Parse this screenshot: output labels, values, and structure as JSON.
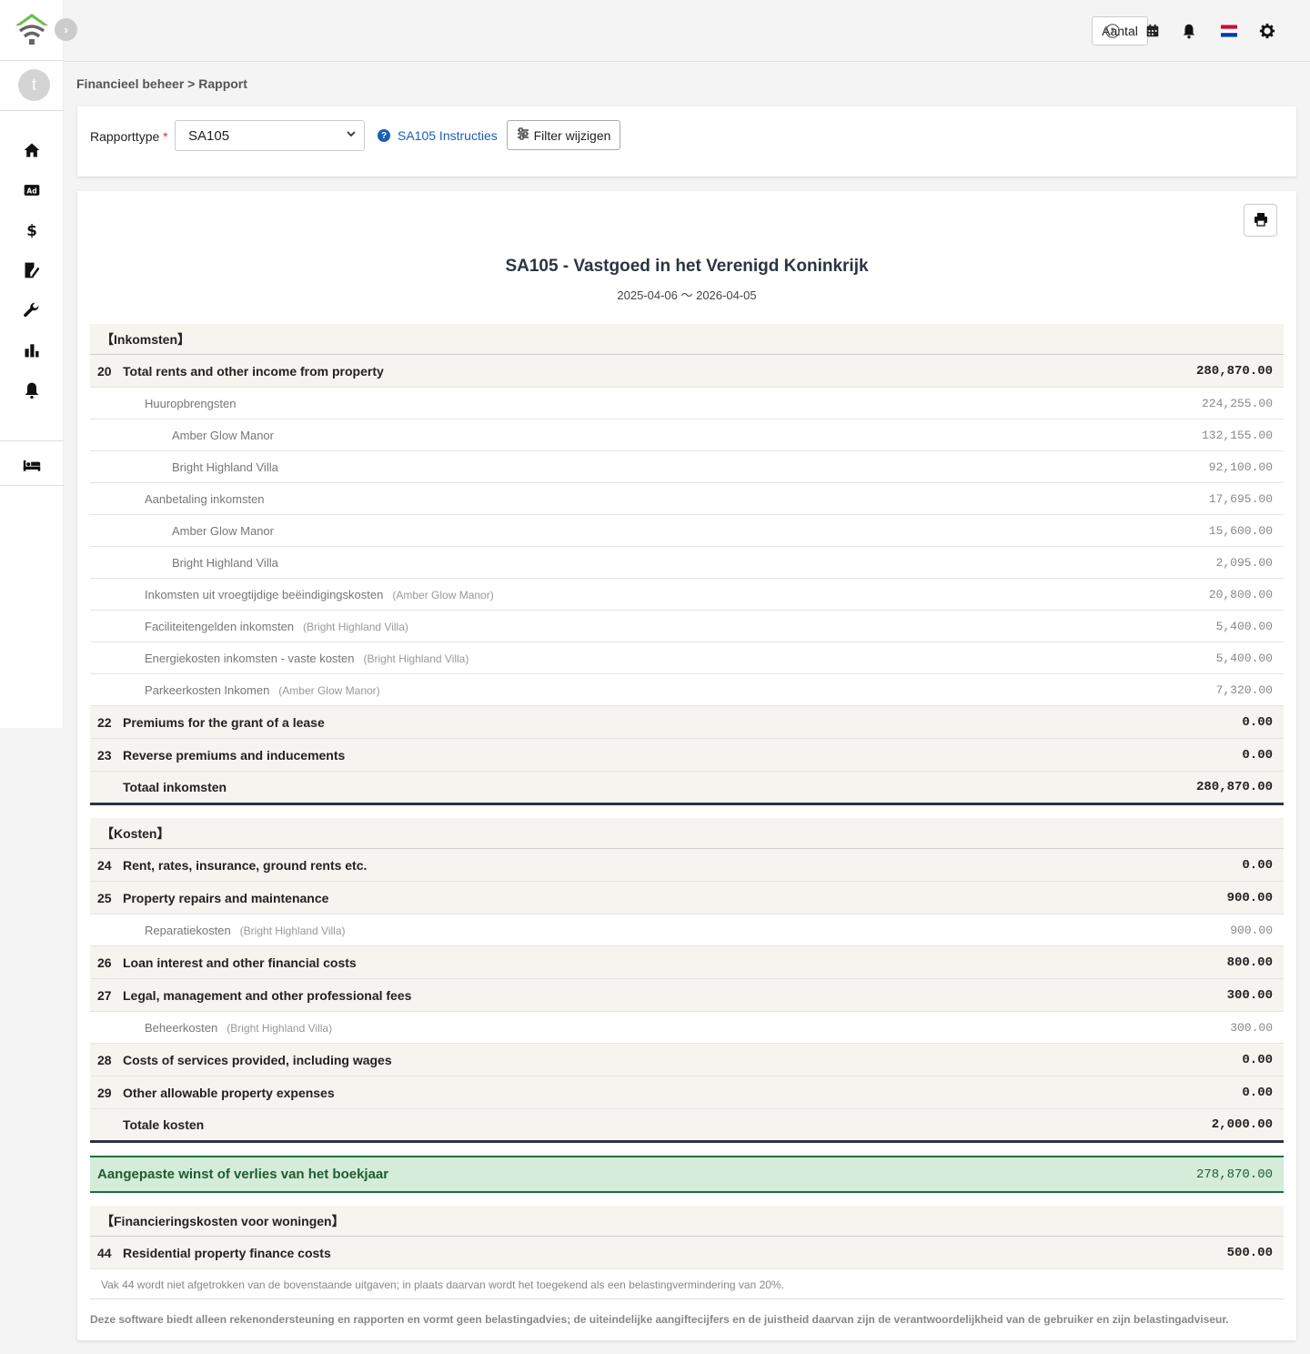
{
  "app": {
    "avatar_letter": "t"
  },
  "topbar": {
    "aantal_label": "Aantal"
  },
  "breadcrumb": {
    "parent": "Financieel beheer",
    "separator": ">",
    "current": "Rapport"
  },
  "filter": {
    "type_label": "Rapporttype",
    "required_mark": "*",
    "selected_type": "SA105",
    "instructions_label": "SA105 Instructies",
    "filter_button_label": "Filter wijzigen"
  },
  "report": {
    "title": "SA105 - Vastgoed in het Verenigd Koninkrijk",
    "period": "2025-04-06 〜 2026-04-05",
    "income": {
      "section_label": "【Inkomsten】",
      "box20": {
        "num": "20",
        "label": "Total rents and other income from property",
        "amount": "280,870.00"
      },
      "rent_income": {
        "label": "Huuropbrengsten",
        "amount": "224,255.00"
      },
      "rent_amber": {
        "label": "Amber Glow Manor",
        "amount": "132,155.00"
      },
      "rent_bright": {
        "label": "Bright Highland Villa",
        "amount": "92,100.00"
      },
      "deposit_income": {
        "label": "Aanbetaling inkomsten",
        "amount": "17,695.00"
      },
      "deposit_amber": {
        "label": "Amber Glow Manor",
        "amount": "15,600.00"
      },
      "deposit_bright": {
        "label": "Bright Highland Villa",
        "amount": "2,095.00"
      },
      "early_term": {
        "label": "Inkomsten uit vroegtijdige beëindigingskosten",
        "property": "(Amber Glow Manor)",
        "amount": "20,800.00"
      },
      "facility": {
        "label": "Faciliteitengelden inkomsten",
        "property": "(Bright Highland Villa)",
        "amount": "5,400.00"
      },
      "energy": {
        "label": "Energiekosten inkomsten - vaste kosten",
        "property": "(Bright Highland Villa)",
        "amount": "5,400.00"
      },
      "parking": {
        "label": "Parkeerkosten Inkomen",
        "property": "(Amber Glow Manor)",
        "amount": "7,320.00"
      },
      "box22": {
        "num": "22",
        "label": "Premiums for the grant of a lease",
        "amount": "0.00"
      },
      "box23": {
        "num": "23",
        "label": "Reverse premiums and inducements",
        "amount": "0.00"
      },
      "total": {
        "label": "Totaal inkomsten",
        "amount": "280,870.00"
      }
    },
    "expenses": {
      "section_label": "【Kosten】",
      "box24": {
        "num": "24",
        "label": "Rent, rates, insurance, ground rents etc.",
        "amount": "0.00"
      },
      "box25": {
        "num": "25",
        "label": "Property repairs and maintenance",
        "amount": "900.00"
      },
      "repair": {
        "label": "Reparatiekosten",
        "property": "(Bright Highland Villa)",
        "amount": "900.00"
      },
      "box26": {
        "num": "26",
        "label": "Loan interest and other financial costs",
        "amount": "800.00"
      },
      "box27": {
        "num": "27",
        "label": "Legal, management and other professional fees",
        "amount": "300.00"
      },
      "management": {
        "label": "Beheerkosten",
        "property": "(Bright Highland Villa)",
        "amount": "300.00"
      },
      "box28": {
        "num": "28",
        "label": "Costs of services provided, including wages",
        "amount": "0.00"
      },
      "box29": {
        "num": "29",
        "label": "Other allowable property expenses",
        "amount": "0.00"
      },
      "total": {
        "label": "Totale kosten",
        "amount": "2,000.00"
      }
    },
    "profit": {
      "label": "Aangepaste winst of verlies van het boekjaar",
      "amount": "278,870.00"
    },
    "finance": {
      "section_label": "【Financieringskosten voor woningen】",
      "box44": {
        "num": "44",
        "label": "Residential property finance costs",
        "amount": "500.00"
      },
      "note": "Vak 44 wordt niet afgetrokken van de bovenstaande uitgaven; in plaats daarvan wordt het toegekend als een belastingvermindering van 20%."
    },
    "disclaimer": "Deze software biedt alleen rekenondersteuning en rapporten en vormt geen belastingadvies; de uiteindelijke aangiftecijfers en de juistheid daarvan zijn de verantwoordelijkheid van de gebruiker en zijn belastingadviseur."
  }
}
